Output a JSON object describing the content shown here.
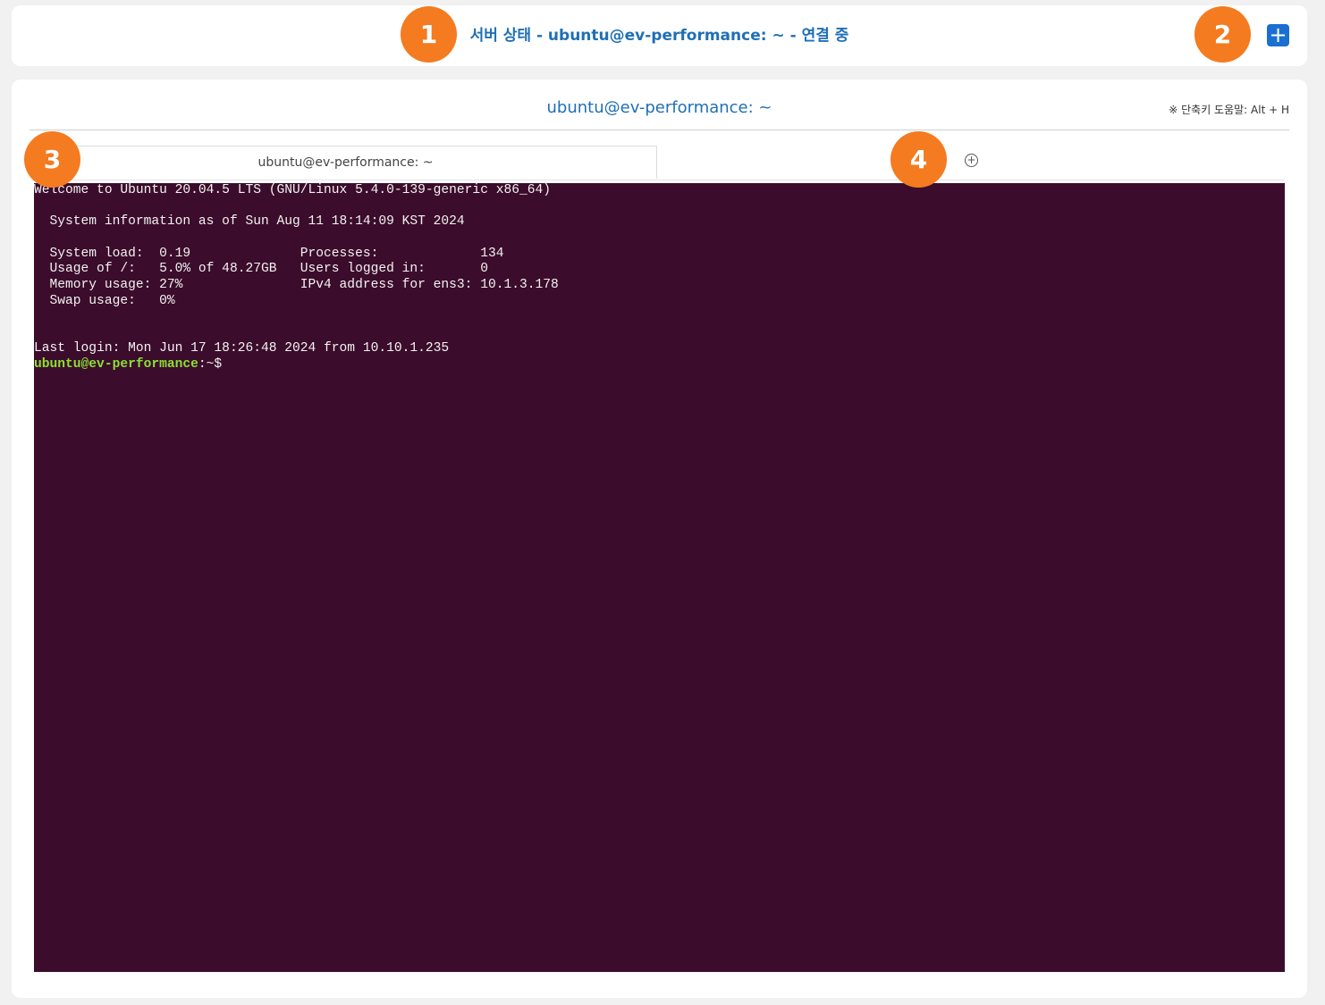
{
  "header": {
    "title": "서버 상태 - ubuntu@ev-performance: ~ - 연결 중",
    "add_button_icon": "plus-icon",
    "add_button_label": "+"
  },
  "session": {
    "title": "ubuntu@ev-performance: ~",
    "shortcut_help": "※ 단축키 도움말: Alt + H"
  },
  "tabs": {
    "items": [
      {
        "label": "ubuntu@ev-performance: ~",
        "active": true
      }
    ],
    "add_tab_icon": "circle-plus-icon",
    "add_tab_label": "+"
  },
  "terminal": {
    "background": "#3b0c2b",
    "prompt_color": "#8ae234",
    "lines": [
      "Welcome to Ubuntu 20.04.5 LTS (GNU/Linux 5.4.0-139-generic x86_64)",
      "",
      "  System information as of Sun Aug 11 18:14:09 KST 2024",
      "",
      "  System load:  0.19              Processes:             134",
      "  Usage of /:   5.0% of 48.27GB   Users logged in:       0",
      "  Memory usage: 27%               IPv4 address for ens3: 10.1.3.178",
      "  Swap usage:   0%",
      "",
      "",
      "Last login: Mon Jun 17 18:26:48 2024 from 10.10.1.235"
    ],
    "prompt_user": "ubuntu@ev-performance",
    "prompt_suffix": ":~$"
  },
  "badges": [
    "1",
    "2",
    "3",
    "4"
  ],
  "colors": {
    "accent": "#1f6fb5",
    "button": "#1a6fd0",
    "badge": "#f47b20"
  }
}
